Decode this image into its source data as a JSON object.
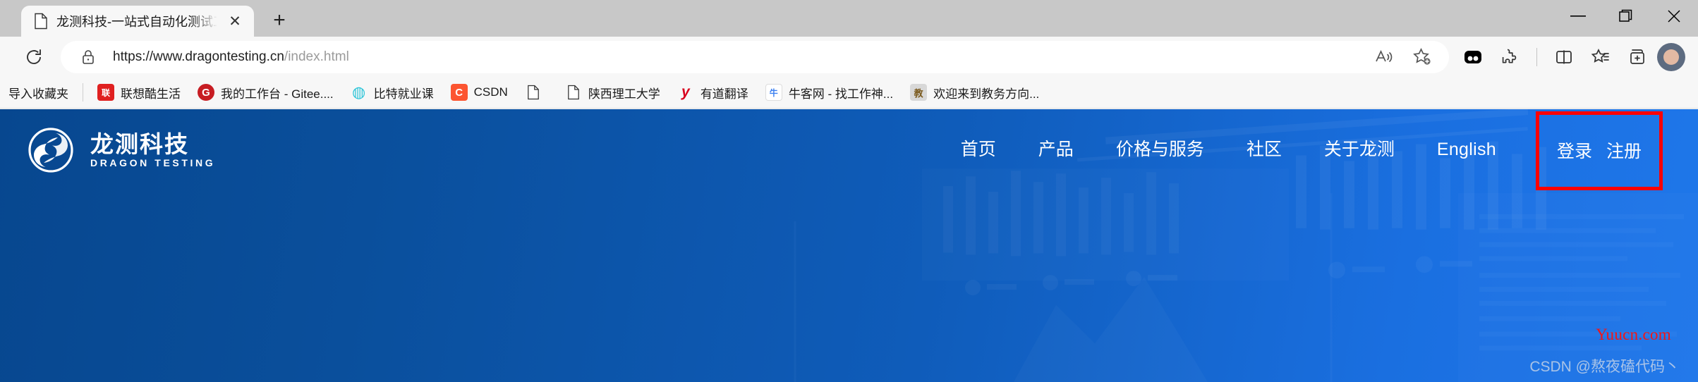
{
  "browser": {
    "tab": {
      "title": "龙测科技-一站式自动化测试工具",
      "favicon_icon": "page-icon",
      "close_icon": "close-icon"
    },
    "new_tab_label": "+",
    "window_controls": {
      "minimize": "—",
      "maximize_icon": "restore-icon",
      "close_icon": "window-close-icon"
    },
    "toolbar": {
      "reload_icon": "reload-icon",
      "lock_icon": "lock-icon",
      "url_main": "https://www.dragontesting.cn",
      "url_path": "/index.html",
      "read_aloud_icon": "read-aloud-icon",
      "add_favorite_icon": "add-favorite-icon",
      "extension_icon": "extension-app-icon",
      "extensions_icon": "puzzle-piece-icon",
      "split_screen_icon": "split-screen-icon",
      "collections_icon": "collections-icon",
      "tab_actions_icon": "add-collection-icon",
      "profile_icon": "profile-avatar"
    },
    "bookmarks": [
      {
        "label": "导入收藏夹",
        "icon": "import-favorites-icon",
        "icon_class": "ico-page",
        "glyph": ""
      },
      {
        "label": "联想酷生活",
        "icon": "lenovo-icon",
        "icon_class": "ico-lenovo",
        "glyph": "联"
      },
      {
        "label": "我的工作台 - Gitee....",
        "icon": "gitee-icon",
        "icon_class": "ico-gitee",
        "glyph": "G"
      },
      {
        "label": "比特就业课",
        "icon": "bite-icon",
        "icon_class": "ico-bite",
        "glyph": "◍"
      },
      {
        "label": "CSDN",
        "icon": "csdn-icon",
        "icon_class": "ico-csdn",
        "glyph": "C"
      },
      {
        "label": "",
        "icon": "blank-page-icon",
        "icon_class": "ico-page",
        "glyph": ""
      },
      {
        "label": "陕西理工大学",
        "icon": "blank-page-icon",
        "icon_class": "ico-page",
        "glyph": ""
      },
      {
        "label": "有道翻译",
        "icon": "youdao-icon",
        "icon_class": "ico-youdao",
        "glyph": "y"
      },
      {
        "label": "牛客网 - 找工作神...",
        "icon": "nowcoder-icon",
        "icon_class": "ico-nowcoder",
        "glyph": "牛"
      },
      {
        "label": "欢迎来到教务方向...",
        "icon": "jiaowu-icon",
        "icon_class": "ico-jiaowu",
        "glyph": "教"
      }
    ]
  },
  "site": {
    "logo": {
      "mark_icon": "dragon-testing-logo-icon",
      "name_cn": "龙测科技",
      "name_en": "DRAGON TESTING"
    },
    "nav": [
      {
        "label": "首页"
      },
      {
        "label": "产品"
      },
      {
        "label": "价格与服务"
      },
      {
        "label": "社区"
      },
      {
        "label": "关于龙测"
      },
      {
        "label": "English"
      }
    ],
    "auth": {
      "login_label": "登录",
      "register_label": "注册",
      "highlight_color": "#ff0000"
    },
    "colors": {
      "hero_gradient_start": "#07478f",
      "hero_gradient_end": "#1f77ea",
      "text": "#ffffff"
    }
  },
  "watermarks": {
    "yuucn": "Yuucn.com",
    "csdn": "CSDN @熬夜磕代码丶"
  }
}
